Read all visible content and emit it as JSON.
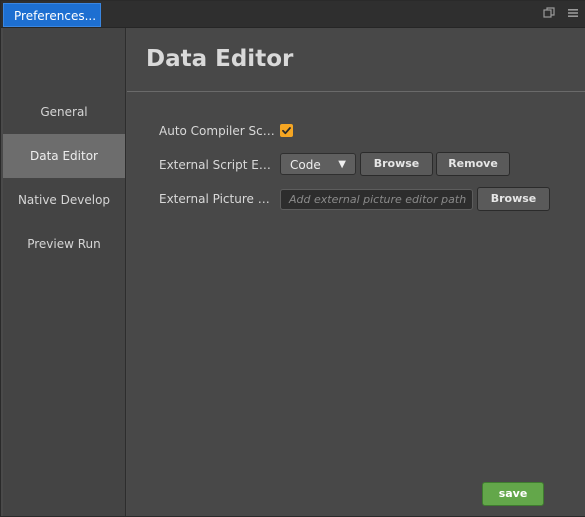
{
  "window": {
    "tab_title": "Preferences...",
    "icons": [
      "maximize-icon",
      "menu-icon"
    ]
  },
  "sidebar": {
    "items": [
      {
        "label": "General"
      },
      {
        "label": "Data Editor",
        "active": true
      },
      {
        "label": "Native Develop"
      },
      {
        "label": "Preview Run"
      }
    ]
  },
  "main": {
    "title": "Data Editor",
    "rows": {
      "auto_compiler": {
        "label": "Auto Compiler Scrip...",
        "checked": true
      },
      "external_script_editor": {
        "label": "External Script Editor",
        "selected": "Code",
        "browse_label": "Browse",
        "remove_label": "Remove"
      },
      "external_picture_editor": {
        "label": "External Picture Edit...",
        "placeholder": "Add external picture editor path",
        "browse_label": "Browse"
      }
    },
    "save_label": "save"
  },
  "colors": {
    "tab_active": "#1d6fd1",
    "checkbox": "#f5a623",
    "save_button": "#63a74a"
  }
}
